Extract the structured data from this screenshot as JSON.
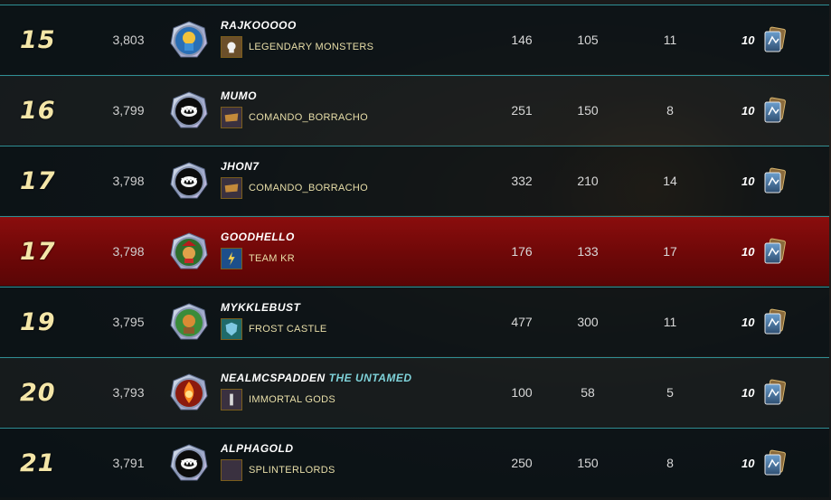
{
  "leaderboard": {
    "rows": [
      {
        "rank": "15",
        "rating": "3,803",
        "player": "RAJKOOOOO",
        "title": "",
        "guild": "LEGENDARY MONSTERS",
        "battles": "146",
        "wins": "105",
        "streak": "11",
        "level": "10",
        "avatar_icon": "dragon-rider-icon",
        "guild_icon": "skull-banner-icon",
        "highlight": false
      },
      {
        "rank": "16",
        "rating": "3,799",
        "player": "MUMO",
        "title": "",
        "guild": "COMANDO_BORRACHO",
        "battles": "251",
        "wins": "150",
        "streak": "8",
        "level": "10",
        "avatar_icon": "fanged-mouth-icon",
        "guild_icon": "scroll-banner-icon",
        "highlight": false
      },
      {
        "rank": "17",
        "rating": "3,798",
        "player": "JHON7",
        "title": "",
        "guild": "COMANDO_BORRACHO",
        "battles": "332",
        "wins": "210",
        "streak": "14",
        "level": "10",
        "avatar_icon": "fanged-mouth-icon",
        "guild_icon": "scroll-banner-icon",
        "highlight": false
      },
      {
        "rank": "17",
        "rating": "3,798",
        "player": "GOODHELLO",
        "title": "",
        "guild": "TEAM KR",
        "battles": "176",
        "wins": "133",
        "streak": "17",
        "level": "10",
        "avatar_icon": "goblin-portrait-icon",
        "guild_icon": "lightning-banner-icon",
        "highlight": true
      },
      {
        "rank": "19",
        "rating": "3,795",
        "player": "MYKKLEBUST",
        "title": "",
        "guild": "FROST CASTLE",
        "battles": "477",
        "wins": "300",
        "streak": "11",
        "level": "10",
        "avatar_icon": "orc-portrait-icon",
        "guild_icon": "shield-banner-icon",
        "highlight": false
      },
      {
        "rank": "20",
        "rating": "3,793",
        "player": "NEALMCSPADDEN",
        "title": "THE UNTAMED",
        "guild": "IMMORTAL GODS",
        "battles": "100",
        "wins": "58",
        "streak": "5",
        "level": "10",
        "avatar_icon": "fire-spirit-icon",
        "guild_icon": "pillar-banner-icon",
        "highlight": false
      },
      {
        "rank": "21",
        "rating": "3,791",
        "player": "ALPHAGOLD",
        "title": "",
        "guild": "SPLINTERLORDS",
        "battles": "250",
        "wins": "150",
        "streak": "8",
        "level": "10",
        "avatar_icon": "fanged-mouth-icon",
        "guild_icon": "blank-banner-icon",
        "highlight": false
      }
    ]
  },
  "colors": {
    "row_border": "#2f8f95",
    "highlight_row": "#7a0a0a",
    "rank_text": "#f4e6a8",
    "guild_text": "#e9dfa9",
    "title_text": "#7fd3da"
  }
}
